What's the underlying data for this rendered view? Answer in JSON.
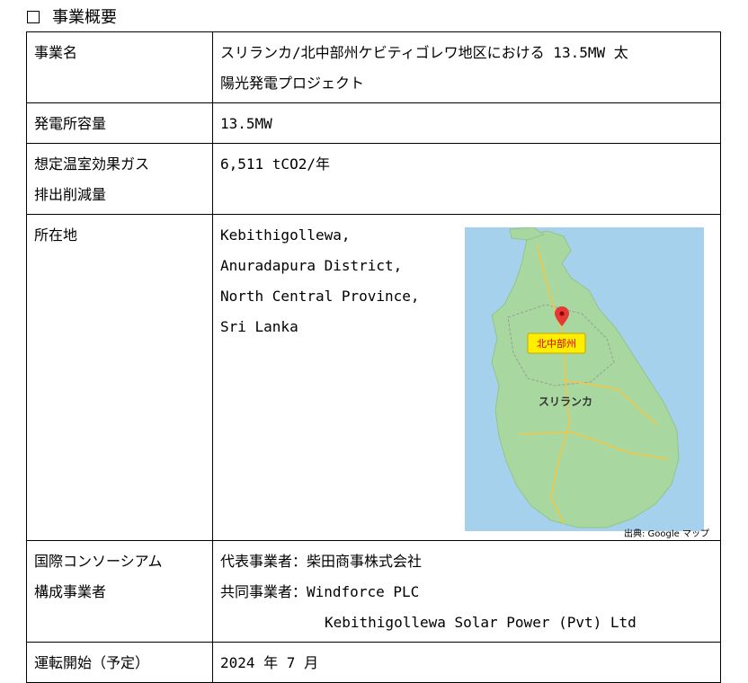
{
  "heading": "事業概要",
  "rows": {
    "name": {
      "label": "事業名",
      "value_lines": [
        "スリランカ/北中部州ケビティゴレワ地区における 13.5MW 太",
        "陽光発電プロジェクト"
      ]
    },
    "capacity": {
      "label": "発電所容量",
      "value": "13.5MW"
    },
    "ghg": {
      "label_lines": [
        "想定温室効果ガス",
        "排出削減量"
      ],
      "value": "6,511 tCO2/年"
    },
    "location": {
      "label": "所在地",
      "value_lines": [
        "Kebithigollewa,",
        "Anuradapura District,",
        "North Central Province,",
        "Sri Lanka"
      ],
      "map": {
        "province_label": "北中部州",
        "country_label": "スリランカ",
        "credit": "出典: Google マップ",
        "colors": {
          "land": "#a8d8a0",
          "sea": "#a6d1ec",
          "label_bg": "#ffee00",
          "label_text": "#d60000",
          "pin": "#e53935"
        }
      }
    },
    "consortium": {
      "label_lines": [
        "国際コンソーシアム",
        "構成事業者"
      ],
      "rep_label": "代表事業者：",
      "rep_value": "柴田商事株式会社",
      "co_label": "共同事業者：",
      "co_values": [
        "Windforce PLC",
        "Kebithigollewa Solar Power (Pvt) Ltd"
      ]
    },
    "start": {
      "label": "運転開始（予定）",
      "value": "2024 年 7 月"
    }
  }
}
